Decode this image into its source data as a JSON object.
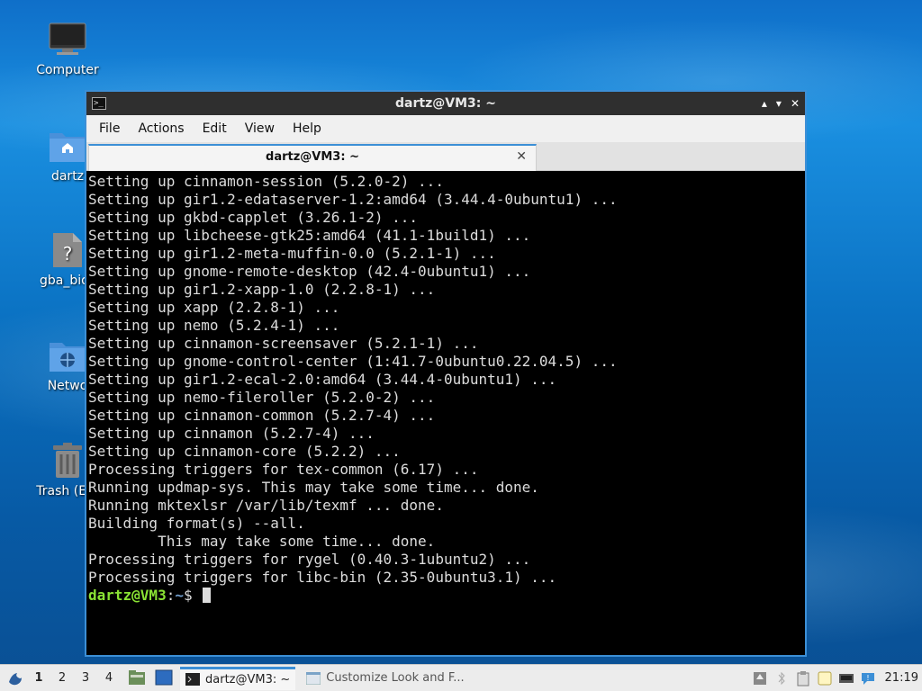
{
  "desktop": {
    "icons": [
      {
        "label": "Computer"
      },
      {
        "label": "dartz"
      },
      {
        "label": "gba_bios"
      },
      {
        "label": "Netwo"
      },
      {
        "label": "Trash (Em"
      }
    ]
  },
  "window": {
    "title": "dartz@VM3: ~",
    "controls": {
      "minimize": "▴",
      "maximize": "▾",
      "close": "✕"
    },
    "menu": [
      "File",
      "Actions",
      "Edit",
      "View",
      "Help"
    ],
    "tab": {
      "label": "dartz@VM3: ~",
      "close": "✕"
    },
    "terminal": {
      "lines": [
        "Setting up cinnamon-session (5.2.0-2) ...",
        "Setting up gir1.2-edataserver-1.2:amd64 (3.44.4-0ubuntu1) ...",
        "Setting up gkbd-capplet (3.26.1-2) ...",
        "Setting up libcheese-gtk25:amd64 (41.1-1build1) ...",
        "Setting up gir1.2-meta-muffin-0.0 (5.2.1-1) ...",
        "Setting up gnome-remote-desktop (42.4-0ubuntu1) ...",
        "Setting up gir1.2-xapp-1.0 (2.2.8-1) ...",
        "Setting up xapp (2.2.8-1) ...",
        "Setting up nemo (5.2.4-1) ...",
        "Setting up cinnamon-screensaver (5.2.1-1) ...",
        "Setting up gnome-control-center (1:41.7-0ubuntu0.22.04.5) ...",
        "Setting up gir1.2-ecal-2.0:amd64 (3.44.4-0ubuntu1) ...",
        "Setting up nemo-fileroller (5.2.0-2) ...",
        "Setting up cinnamon-common (5.2.7-4) ...",
        "Setting up cinnamon (5.2.7-4) ...",
        "Setting up cinnamon-core (5.2.2) ...",
        "Processing triggers for tex-common (6.17) ...",
        "Running updmap-sys. This may take some time... done.",
        "Running mktexlsr /var/lib/texmf ... done.",
        "Building format(s) --all.",
        "        This may take some time... done.",
        "Processing triggers for rygel (0.40.3-1ubuntu2) ...",
        "Processing triggers for libc-bin (2.35-0ubuntu3.1) ..."
      ],
      "prompt_user": "dartz@VM3",
      "prompt_sep": ":",
      "prompt_path": "~",
      "prompt_symbol": "$ "
    }
  },
  "taskbar": {
    "workspaces": [
      "1",
      "2",
      "3",
      "4"
    ],
    "tasks": [
      {
        "label": "dartz@VM3: ~",
        "active": true
      },
      {
        "label": "Customize Look and F...",
        "active": false
      }
    ],
    "clock": "21:19"
  },
  "colors": {
    "accent": "#3c8fd6",
    "prompt_user": "#8ae234",
    "prompt_path": "#729fcf"
  }
}
